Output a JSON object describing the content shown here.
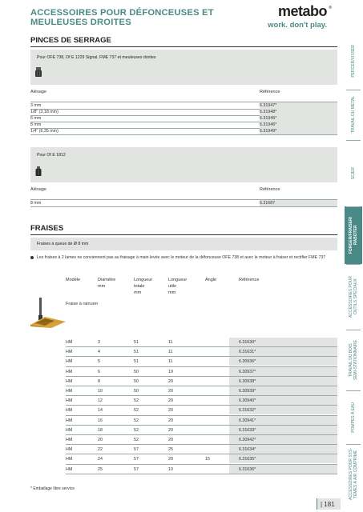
{
  "header": {
    "title": "ACCESSOIRES POUR DÉFONCEUSES ET MEULEUSES DROITES",
    "logo": "metabo",
    "tagline": "work. don't play."
  },
  "pinces": {
    "title": "PINCES DE SERRAGE",
    "group1_label": "Pour OFE 738, Of E 1229 Signal, FME 737 et meuleuses droites",
    "col_alesage": "Alésage",
    "col_reference": "Référence",
    "rows1": [
      {
        "alesage": "3 mm",
        "ref": "6.31947*"
      },
      {
        "alesage": "1/8\" (3,18 mm)",
        "ref": "6.31948*"
      },
      {
        "alesage": "6 mm",
        "ref": "6.31945*"
      },
      {
        "alesage": "8 mm",
        "ref": "6.31946*"
      },
      {
        "alesage": "1/4\" (6,35 mm)",
        "ref": "6.31949*"
      }
    ],
    "group2_label": "Pour Of E 1812",
    "rows2": [
      {
        "alesage": "8 mm",
        "ref": "6.31687"
      }
    ]
  },
  "fraises": {
    "title": "FRAISES",
    "group_label": "Fraises à queue de Ø 8 mm",
    "bullet": "Les fraises à 2 lames ne conviennent pas au fraisage à main levée avec le moteur de la défonceuse OFE 738 et avec le moteur à fraiser et rectifier FME 737",
    "headers": {
      "modele": "Modèle",
      "diametre": "Diamètre",
      "diametre_unit": "mm",
      "longueur_totale": "Longueur",
      "longueur_totale_2": "totale",
      "longueur_totale_unit": "mm",
      "longueur_utile": "Longueur",
      "longueur_utile_2": "utile",
      "longueur_utile_unit": "mm",
      "angle": "Angle",
      "reference": "Référence"
    },
    "subtype": "Fraise à rainurer",
    "rows": [
      {
        "modele": "HM",
        "diam": "3",
        "lt": "51",
        "lu": "11",
        "angle": "",
        "ref": "6.31630*"
      },
      {
        "modele": "HM",
        "diam": "4",
        "lt": "51",
        "lu": "11",
        "angle": "",
        "ref": "6.31631*"
      },
      {
        "modele": "HM",
        "diam": "5",
        "lt": "51",
        "lu": "11",
        "angle": "",
        "ref": "6.30936*"
      },
      {
        "modele": "HM",
        "diam": "6",
        "lt": "50",
        "lu": "19",
        "angle": "",
        "ref": "6.30937*"
      },
      {
        "modele": "HM",
        "diam": "8",
        "lt": "50",
        "lu": "20",
        "angle": "",
        "ref": "6.30938*"
      },
      {
        "modele": "HM",
        "diam": "10",
        "lt": "50",
        "lu": "20",
        "angle": "",
        "ref": "6.30939*"
      },
      {
        "modele": "HM",
        "diam": "12",
        "lt": "52",
        "lu": "20",
        "angle": "",
        "ref": "6.30940*"
      },
      {
        "modele": "HM",
        "diam": "14",
        "lt": "52",
        "lu": "20",
        "angle": "",
        "ref": "6.31632*"
      },
      {
        "modele": "HM",
        "diam": "16",
        "lt": "52",
        "lu": "20",
        "angle": "",
        "ref": "6.30941*"
      },
      {
        "modele": "HM",
        "diam": "18",
        "lt": "52",
        "lu": "20",
        "angle": "",
        "ref": "6.31633*"
      },
      {
        "modele": "HM",
        "diam": "20",
        "lt": "52",
        "lu": "20",
        "angle": "",
        "ref": "6.30942*"
      },
      {
        "modele": "HM",
        "diam": "22",
        "lt": "57",
        "lu": "25",
        "angle": "",
        "ref": "6.31634*"
      },
      {
        "modele": "HM",
        "diam": "24",
        "lt": "57",
        "lu": "20",
        "angle": "15",
        "ref": "6.31635*"
      },
      {
        "modele": "HM",
        "diam": "25",
        "lt": "57",
        "lu": "10",
        "angle": "",
        "ref": "6.31636*"
      }
    ]
  },
  "footnote": "* Emballage libre service",
  "page_number": "| 181",
  "sidetabs": [
    "PERCER/VISSER",
    "TRAVAIL DU MÉTAL",
    "SCIER",
    "FORGER/FRAISER/\nRABOTER",
    "ACCESSOIRES POUR\nOUTILS SPÉCIAUX",
    "TRAVAIL DU BOIS\nSEMI-STATIONNAIRE",
    "POMPES À EAU",
    "ACCESSOIRES POUR SYS-\nTÈMES À AIR COMPRIMÉ"
  ],
  "colors": {
    "accent": "#4a8a86",
    "table_bg": "#e2e4e2"
  }
}
